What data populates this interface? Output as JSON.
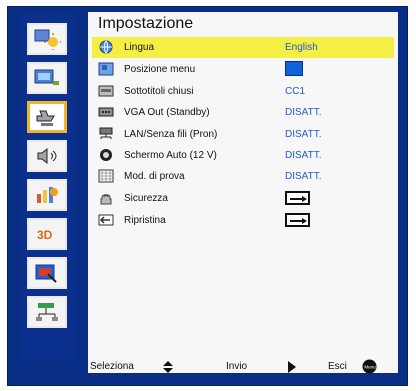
{
  "title": "Impostazione",
  "menu_rows": [
    {
      "label": "Lingua",
      "value": "English",
      "icon": "globe-icon",
      "selected": true
    },
    {
      "label": "Posizione menu",
      "value": "",
      "icon": "menu-position-icon",
      "selected": false,
      "indicator": "blue-square"
    },
    {
      "label": "Sottotitoli chiusi",
      "value": "CC1",
      "icon": "closed-caption-icon",
      "selected": false
    },
    {
      "label": "VGA Out (Standby)",
      "value": "DISATT.",
      "icon": "vga-icon",
      "selected": false
    },
    {
      "label": "LAN/Senza fili (Pron)",
      "value": "DISATT.",
      "icon": "lan-icon",
      "selected": false
    },
    {
      "label": "Schermo Auto (12 V)",
      "value": "DISATT.",
      "icon": "screen-icon",
      "selected": false
    },
    {
      "label": "Mod. di prova",
      "value": "DISATT.",
      "icon": "test-pattern-icon",
      "selected": false
    },
    {
      "label": "Sicurezza",
      "value": "",
      "icon": "security-icon",
      "selected": false,
      "indicator": "arrow-box"
    },
    {
      "label": "Ripristina",
      "value": "",
      "icon": "reset-icon",
      "selected": false,
      "indicator": "arrow-box"
    }
  ],
  "footer": {
    "select_label": "Seleziona",
    "enter_label": "Invio",
    "exit_label": "Esci",
    "menu_label": "Menu"
  },
  "sidebar": [
    {
      "name": "image-settings-icon",
      "active": false
    },
    {
      "name": "display-settings-icon",
      "active": false
    },
    {
      "name": "setup-settings-icon",
      "active": true
    },
    {
      "name": "audio-icon",
      "active": false
    },
    {
      "name": "options-icon",
      "active": false
    },
    {
      "name": "3d-icon",
      "active": false,
      "text": "3D"
    },
    {
      "name": "interactive-icon",
      "active": false
    },
    {
      "name": "network-icon",
      "active": false
    }
  ],
  "colors": {
    "osd_blue": "#0a2d86",
    "highlight": "#f6ef43",
    "value_blue": "#1f5bd4",
    "active_border": "#f1b52a"
  }
}
